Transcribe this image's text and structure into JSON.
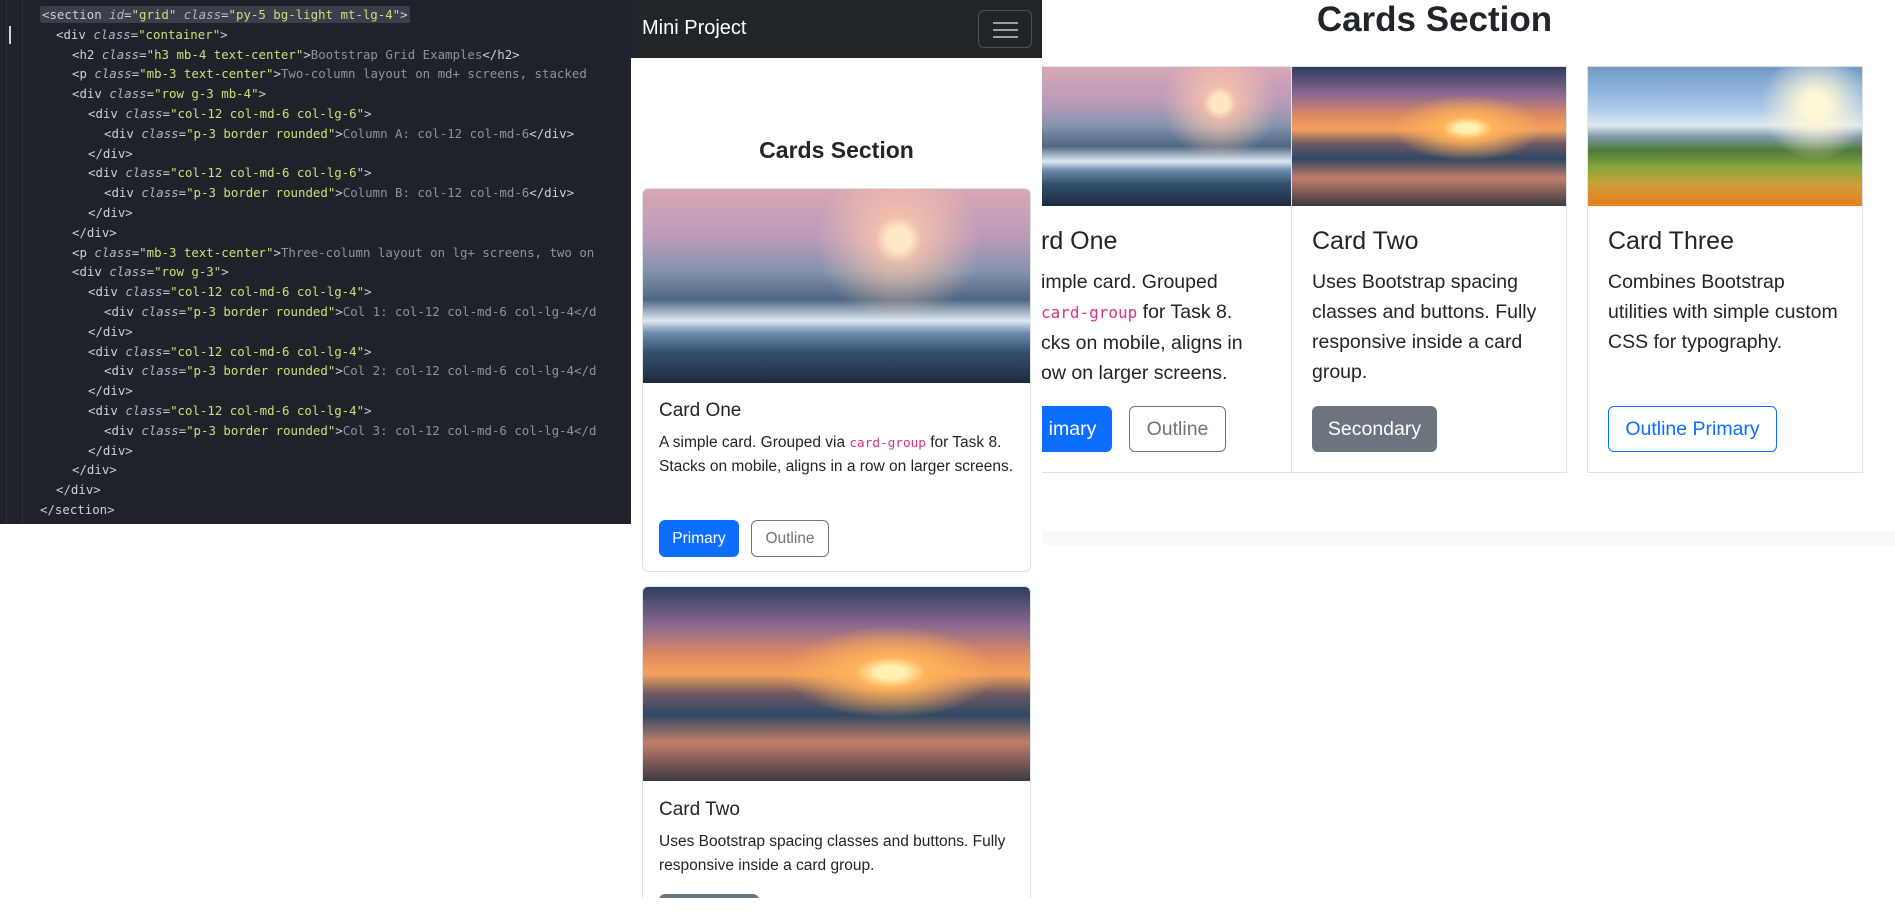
{
  "editor": {
    "lines": [
      {
        "indent": 0,
        "parts": [
          [
            "tag",
            "<section "
          ],
          [
            "attr",
            "id"
          ],
          [
            "tag",
            "="
          ],
          [
            "str",
            "\"grid\""
          ],
          [
            "tag",
            " "
          ],
          [
            "attr",
            "class"
          ],
          [
            "tag",
            "="
          ],
          [
            "str",
            "\"py-5 bg-light mt-lg-4\""
          ],
          [
            "tag",
            ">"
          ]
        ]
      },
      {
        "indent": 1,
        "parts": [
          [
            "tag",
            "<div "
          ],
          [
            "attr",
            "class"
          ],
          [
            "tag",
            "="
          ],
          [
            "str",
            "\"container\""
          ],
          [
            "tag",
            ">"
          ]
        ]
      },
      {
        "indent": 2,
        "parts": [
          [
            "tag",
            "<h2 "
          ],
          [
            "attr",
            "class"
          ],
          [
            "tag",
            "="
          ],
          [
            "str",
            "\"h3 mb-4 text-center\""
          ],
          [
            "tag",
            ">"
          ],
          [
            "txt",
            "Bootstrap Grid Examples"
          ],
          [
            "tag",
            "</h2>"
          ]
        ]
      },
      {
        "indent": 2,
        "parts": [
          [
            "tag",
            "<p "
          ],
          [
            "attr",
            "class"
          ],
          [
            "tag",
            "="
          ],
          [
            "str",
            "\"mb-3 text-center\""
          ],
          [
            "tag",
            ">"
          ],
          [
            "txt",
            "Two-column layout on md+ screens, stacked"
          ]
        ]
      },
      {
        "indent": 2,
        "parts": [
          [
            "tag",
            "<div "
          ],
          [
            "attr",
            "class"
          ],
          [
            "tag",
            "="
          ],
          [
            "str",
            "\"row g-3 mb-4\""
          ],
          [
            "tag",
            ">"
          ]
        ]
      },
      {
        "indent": 3,
        "parts": [
          [
            "tag",
            "<div "
          ],
          [
            "attr",
            "class"
          ],
          [
            "tag",
            "="
          ],
          [
            "str",
            "\"col-12 col-md-6 col-lg-6\""
          ],
          [
            "tag",
            ">"
          ]
        ]
      },
      {
        "indent": 4,
        "parts": [
          [
            "tag",
            "<div "
          ],
          [
            "attr",
            "class"
          ],
          [
            "tag",
            "="
          ],
          [
            "str",
            "\"p-3 border rounded\""
          ],
          [
            "tag",
            ">"
          ],
          [
            "txt",
            "Column A: col-12 col-md-6"
          ],
          [
            "tag",
            "</div>"
          ]
        ]
      },
      {
        "indent": 3,
        "parts": [
          [
            "tag",
            "</div>"
          ]
        ]
      },
      {
        "indent": 3,
        "parts": [
          [
            "tag",
            "<div "
          ],
          [
            "attr",
            "class"
          ],
          [
            "tag",
            "="
          ],
          [
            "str",
            "\"col-12 col-md-6 col-lg-6\""
          ],
          [
            "tag",
            ">"
          ]
        ]
      },
      {
        "indent": 4,
        "parts": [
          [
            "tag",
            "<div "
          ],
          [
            "attr",
            "class"
          ],
          [
            "tag",
            "="
          ],
          [
            "str",
            "\"p-3 border rounded\""
          ],
          [
            "tag",
            ">"
          ],
          [
            "txt",
            "Column B: col-12 col-md-6"
          ],
          [
            "tag",
            "</div>"
          ]
        ]
      },
      {
        "indent": 3,
        "parts": [
          [
            "tag",
            "</div>"
          ]
        ]
      },
      {
        "indent": 2,
        "parts": [
          [
            "tag",
            "</div>"
          ]
        ]
      },
      {
        "indent": 2,
        "parts": [
          [
            "tag",
            "<p "
          ],
          [
            "attr",
            "class"
          ],
          [
            "tag",
            "="
          ],
          [
            "str",
            "\"mb-3 text-center\""
          ],
          [
            "tag",
            ">"
          ],
          [
            "txt",
            "Three-column layout on lg+ screens, two on"
          ]
        ]
      },
      {
        "indent": 2,
        "parts": [
          [
            "tag",
            "<div "
          ],
          [
            "attr",
            "class"
          ],
          [
            "tag",
            "="
          ],
          [
            "str",
            "\"row g-3\""
          ],
          [
            "tag",
            ">"
          ]
        ]
      },
      {
        "indent": 3,
        "parts": [
          [
            "tag",
            "<div "
          ],
          [
            "attr",
            "class"
          ],
          [
            "tag",
            "="
          ],
          [
            "str",
            "\"col-12 col-md-6 col-lg-4\""
          ],
          [
            "tag",
            ">"
          ]
        ]
      },
      {
        "indent": 4,
        "parts": [
          [
            "tag",
            "<div "
          ],
          [
            "attr",
            "class"
          ],
          [
            "tag",
            "="
          ],
          [
            "str",
            "\"p-3 border rounded\""
          ],
          [
            "tag",
            ">"
          ],
          [
            "txt",
            "Col 1: col-12 col-md-6 col-lg-4</d"
          ]
        ]
      },
      {
        "indent": 3,
        "parts": [
          [
            "tag",
            "</div>"
          ]
        ]
      },
      {
        "indent": 3,
        "parts": [
          [
            "tag",
            "<div "
          ],
          [
            "attr",
            "class"
          ],
          [
            "tag",
            "="
          ],
          [
            "str",
            "\"col-12 col-md-6 col-lg-4\""
          ],
          [
            "tag",
            ">"
          ]
        ]
      },
      {
        "indent": 4,
        "parts": [
          [
            "tag",
            "<div "
          ],
          [
            "attr",
            "class"
          ],
          [
            "tag",
            "="
          ],
          [
            "str",
            "\"p-3 border rounded\""
          ],
          [
            "tag",
            ">"
          ],
          [
            "txt",
            "Col 2: col-12 col-md-6 col-lg-4</d"
          ]
        ]
      },
      {
        "indent": 3,
        "parts": [
          [
            "tag",
            "</div>"
          ]
        ]
      },
      {
        "indent": 3,
        "parts": [
          [
            "tag",
            "<div "
          ],
          [
            "attr",
            "class"
          ],
          [
            "tag",
            "="
          ],
          [
            "str",
            "\"col-12 col-md-6 col-lg-4\""
          ],
          [
            "tag",
            ">"
          ]
        ]
      },
      {
        "indent": 4,
        "parts": [
          [
            "tag",
            "<div "
          ],
          [
            "attr",
            "class"
          ],
          [
            "tag",
            "="
          ],
          [
            "str",
            "\"p-3 border rounded\""
          ],
          [
            "tag",
            ">"
          ],
          [
            "txt",
            "Col 3: col-12 col-md-6 col-lg-4</d"
          ]
        ]
      },
      {
        "indent": 3,
        "parts": [
          [
            "tag",
            "</div>"
          ]
        ]
      },
      {
        "indent": 2,
        "parts": [
          [
            "tag",
            "</div>"
          ]
        ]
      },
      {
        "indent": 1,
        "parts": [
          [
            "tag",
            "</div>"
          ]
        ]
      },
      {
        "indent": 0,
        "parts": [
          [
            "tag",
            "</section>"
          ]
        ]
      }
    ]
  },
  "mobile": {
    "brand": "Mini Project",
    "toggler_icon": "hamburger-icon",
    "section_title": "Cards Section",
    "card_one": {
      "title": "Card One",
      "text_before": "A simple card. Grouped via ",
      "code": "card-group",
      "text_after": " for Task 8. Stacks on mobile, aligns in a row on larger screens.",
      "btn_primary": "Primary",
      "btn_outline": "Outline"
    },
    "card_two": {
      "title": "Card Two",
      "text": "Uses Bootstrap spacing classes and buttons. Fully responsive inside a card group."
    }
  },
  "desktop": {
    "section_title": "Cards Section",
    "card_one": {
      "title": "rd One",
      "line1": "imple card. Grouped",
      "code": "card-group",
      "line2_after": " for Task 8.",
      "line3": "cks on mobile, aligns in",
      "line4": "ow on larger screens.",
      "btn_primary": "imary",
      "btn_outline": "Outline"
    },
    "card_two": {
      "title": "Card Two",
      "text": "Uses Bootstrap spacing classes and buttons. Fully responsive inside a card group.",
      "btn": "Secondary"
    },
    "card_three": {
      "title": "Card Three",
      "text": "Combines Bootstrap utilities with simple custom CSS for typography.",
      "btn": "Outline Primary"
    }
  },
  "colors": {
    "primary": "#0d6efd",
    "secondary": "#6c757d",
    "navbar": "#212529",
    "editor_bg": "#1f2329",
    "code_pink": "#d63384"
  }
}
